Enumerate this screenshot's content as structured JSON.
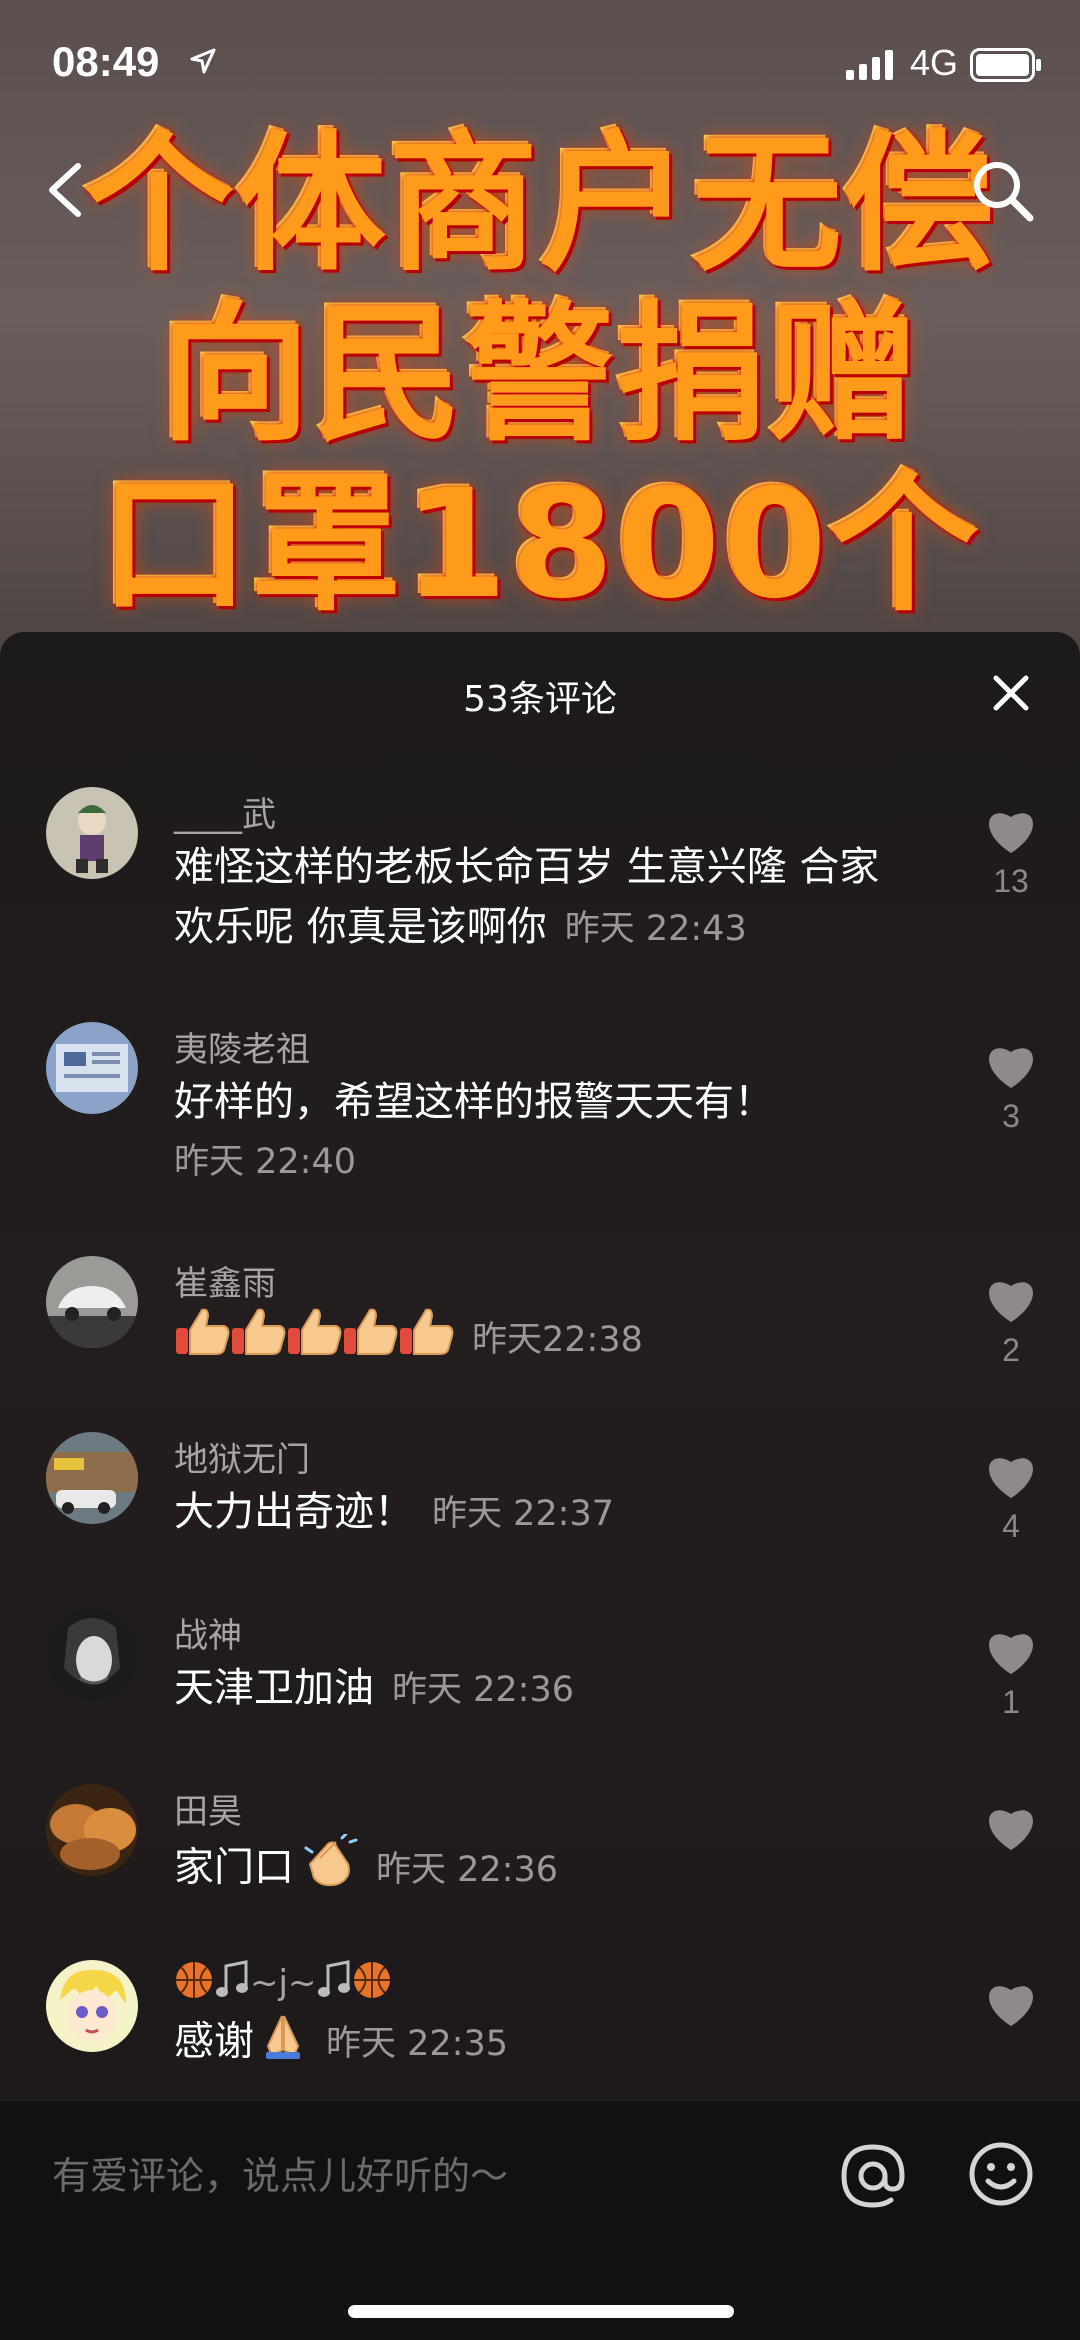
{
  "status": {
    "time": "08:49",
    "network": "4G"
  },
  "video": {
    "title_lines": [
      "个体商户无偿",
      "向民警捐赠",
      "口罩1800个"
    ]
  },
  "panel": {
    "title": "53条评论"
  },
  "comments": [
    {
      "user": "____武",
      "text": "难怪这样的老板长命百岁 生意兴隆 合家欢乐呢 你真是该啊你",
      "time": "昨天 22:43",
      "likes": "13"
    },
    {
      "user": "夷陵老祖",
      "text": "好样的，希望这样的报警天天有！",
      "time": "昨天 22:40",
      "likes": "3"
    },
    {
      "user": "崔鑫雨",
      "text": "",
      "time": "昨天22:38",
      "likes": "2"
    },
    {
      "user": "地狱无门",
      "text": "大力出奇迹！",
      "time": "昨天 22:37",
      "likes": "4"
    },
    {
      "user": "战神",
      "text": "天津卫加油",
      "time": "昨天 22:36",
      "likes": "1"
    },
    {
      "user": "田昊",
      "text": "家门口",
      "time": "昨天 22:36",
      "likes": ""
    },
    {
      "user": "~j~",
      "text": "感谢",
      "time": "昨天 22:35",
      "likes": ""
    }
  ],
  "input": {
    "placeholder": "有爱评论，说点儿好听的～"
  },
  "colors": {
    "panel_bg": "#1d1a1a",
    "like_gray": "#8c8888",
    "title_orange": "#ff9a1a"
  }
}
